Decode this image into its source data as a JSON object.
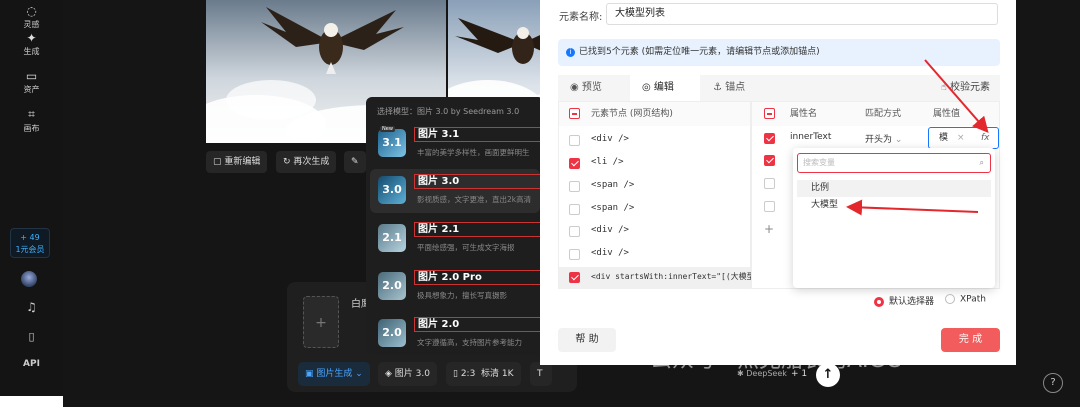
{
  "sidebar": {
    "items": [
      {
        "label": "灵感",
        "icon": "bulb-icon"
      },
      {
        "label": "生成",
        "icon": "sparkle-icon"
      },
      {
        "label": "资产",
        "icon": "folder-icon"
      },
      {
        "label": "画布",
        "icon": "canvas-icon"
      }
    ],
    "promo_count": "+ 49",
    "promo_label": "1元会员",
    "api_label": "API"
  },
  "actions": {
    "reedit": "重新编辑",
    "regenerate": "再次生成"
  },
  "model_popup": {
    "header": "选择模型：图片 3.0 by Seedream 3.0",
    "models": [
      {
        "name": "图片 3.1",
        "desc": "丰富的美学多样性，画面更鲜明生",
        "thumb": "3.1",
        "tag": "New"
      },
      {
        "name": "图片 3.0",
        "desc": "影视质感，文字更准，直出2k高清",
        "thumb": "3.0"
      },
      {
        "name": "图片 2.1",
        "desc": "平面绘感强，可生成文字海报",
        "thumb": "2.1"
      },
      {
        "name": "图片 2.0 Pro",
        "desc": "极具想象力，擅长写真摄影",
        "thumb": "2.0"
      },
      {
        "name": "图片 2.0",
        "desc": "文字遵循高，支持图片参考能力",
        "thumb": "2.0"
      }
    ]
  },
  "composer": {
    "text": "白鹰",
    "chips": {
      "mode": "图片生成",
      "model": "图片 3.0",
      "ratio": "2:3",
      "quality": "标清 1K",
      "text_tool": "T",
      "deepseek": "DeepSeek",
      "count": "+ 1"
    }
  },
  "panel": {
    "name_label": "元素名称:",
    "name_value": "大模型列表",
    "info": "已找到5个元素 (如需定位唯一元素，请编辑节点或添加锚点)",
    "tabs": [
      "预览",
      "编辑",
      "锚点"
    ],
    "verify": "校验元素",
    "left_header": "元素节点 (网页结构)",
    "nodes": [
      "<div />",
      "<li />",
      "<span />",
      "<span />",
      "<div />",
      "<div />",
      "<div startsWith:innerText=\"[(大模型)]\" ..."
    ],
    "node_checked": [
      false,
      true,
      false,
      false,
      false,
      false,
      true
    ],
    "right_headers": [
      "属性名",
      "匹配方式",
      "属性值"
    ],
    "attr_name": "innerText",
    "match_mode": "开头为",
    "attr_value": "模",
    "fx": "fx",
    "dropdown_placeholder": "搜索变量",
    "dropdown_options": [
      "比例",
      "大模型"
    ],
    "add": "+",
    "selector_default": "默认选择器",
    "selector_xpath": "XPath",
    "help": "帮 助",
    "done": "完 成"
  },
  "watermark": "公众号 · 杰克船长的AIGC",
  "help_icon": "?",
  "colors": {
    "accent": "#e34d4d",
    "info_bg": "#e8f2ff",
    "brand_blue": "#1677ff"
  }
}
